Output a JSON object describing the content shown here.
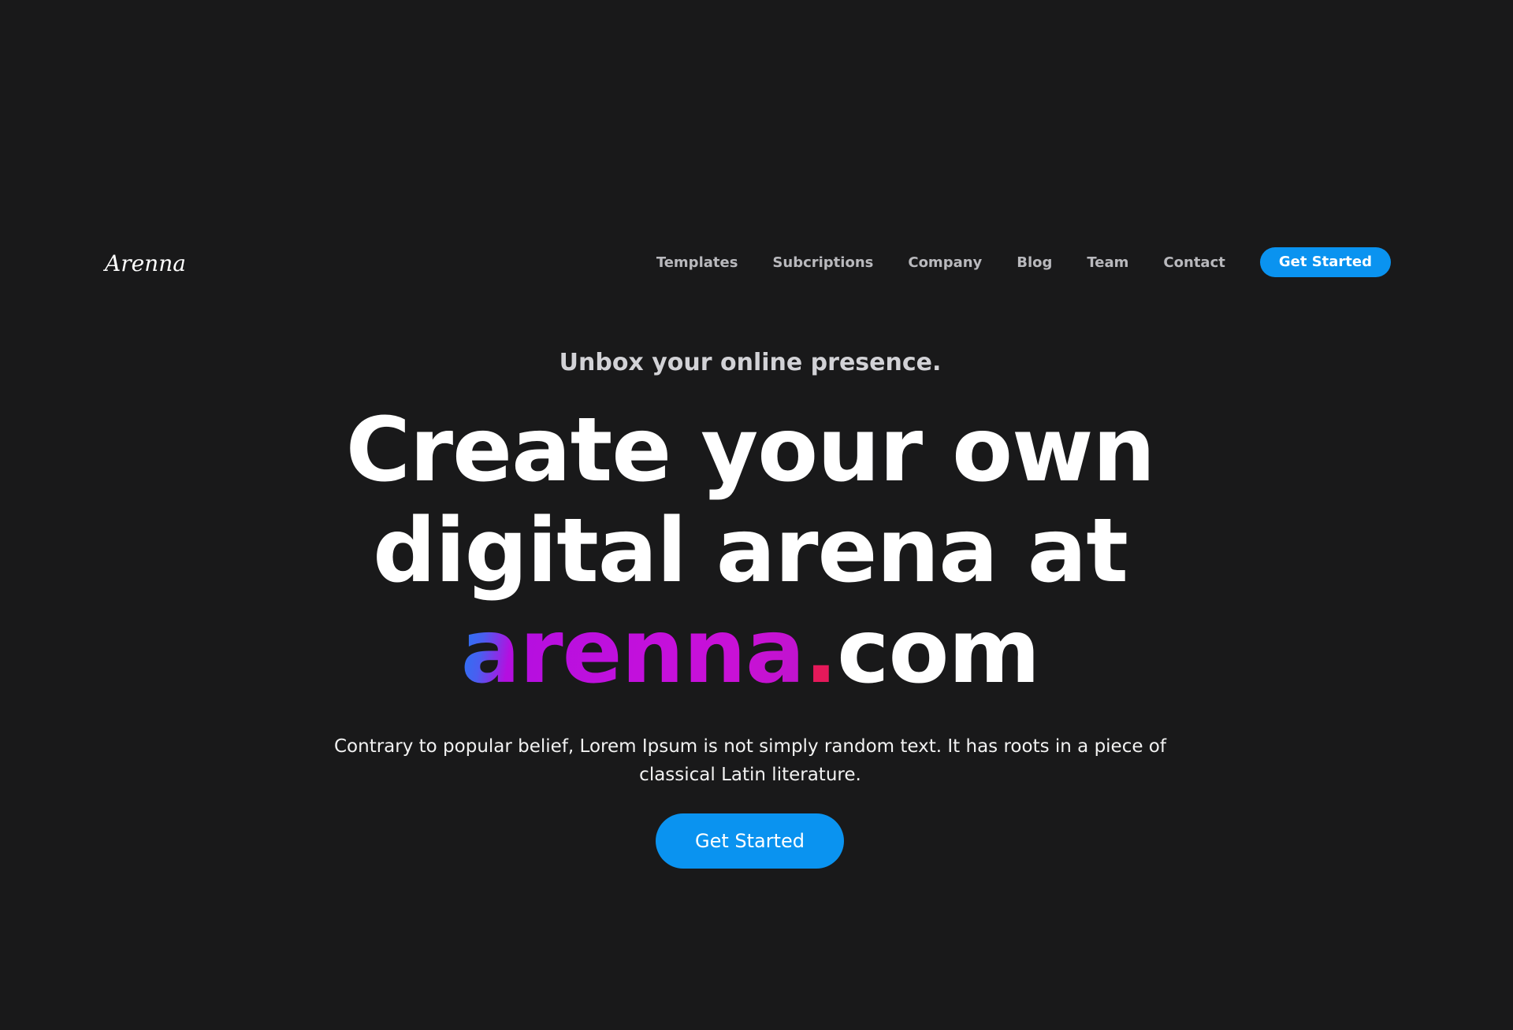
{
  "brand": {
    "logo_text": "Arenna"
  },
  "nav": {
    "links": [
      "Templates",
      "Subcriptions",
      "Company",
      "Blog",
      "Team",
      "Contact"
    ],
    "cta_label": "Get Started"
  },
  "hero": {
    "tagline": "Unbox your online presence.",
    "headline_line1": "Create your own",
    "headline_line2": "digital arena at",
    "headline_brand": "arenna",
    "headline_dot": ".",
    "headline_suffix": "com",
    "description": "Contrary to popular belief, Lorem Ipsum is not simply random text. It has roots in a piece of classical Latin literature.",
    "cta_label": "Get Started"
  },
  "colors": {
    "background": "#19191a",
    "accent": "#0a93f0",
    "brand_magenta": "#c510db",
    "brand_blue": "#1e7cf4",
    "brand_dot": "#e5195a"
  }
}
